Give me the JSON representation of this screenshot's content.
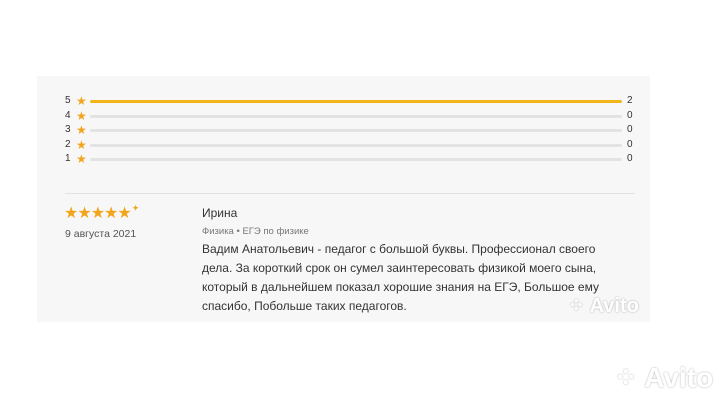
{
  "rating_distribution": [
    {
      "stars": "5",
      "count": "2",
      "fill_fraction": 1.0
    },
    {
      "stars": "4",
      "count": "0",
      "fill_fraction": 0
    },
    {
      "stars": "3",
      "count": "0",
      "fill_fraction": 0
    },
    {
      "stars": "2",
      "count": "0",
      "fill_fraction": 0
    },
    {
      "stars": "1",
      "count": "0",
      "fill_fraction": 0
    }
  ],
  "star_glyph": "★",
  "review": {
    "rating": 5,
    "stars_glyphs": "★★★★★",
    "date": "9 августа 2021",
    "author": "Ирина",
    "subject": "Физика • ЕГЭ по физике",
    "text": "Вадим Анатольевич - педагог с большой буквы. Профессионал своего дела. За короткий срок он сумел заинтересовать физикой моего сына, который в дальнейшем показал хорошие знания на ЕГЭ, Большое ему спасибо, Побольше таких педагогов."
  },
  "watermark": {
    "text": "Avito"
  },
  "colors": {
    "star": "#f2a41d",
    "bar_fill": "#f2b418",
    "bar_track": "#e3e3e6",
    "card_bg": "#f7f7f7"
  }
}
